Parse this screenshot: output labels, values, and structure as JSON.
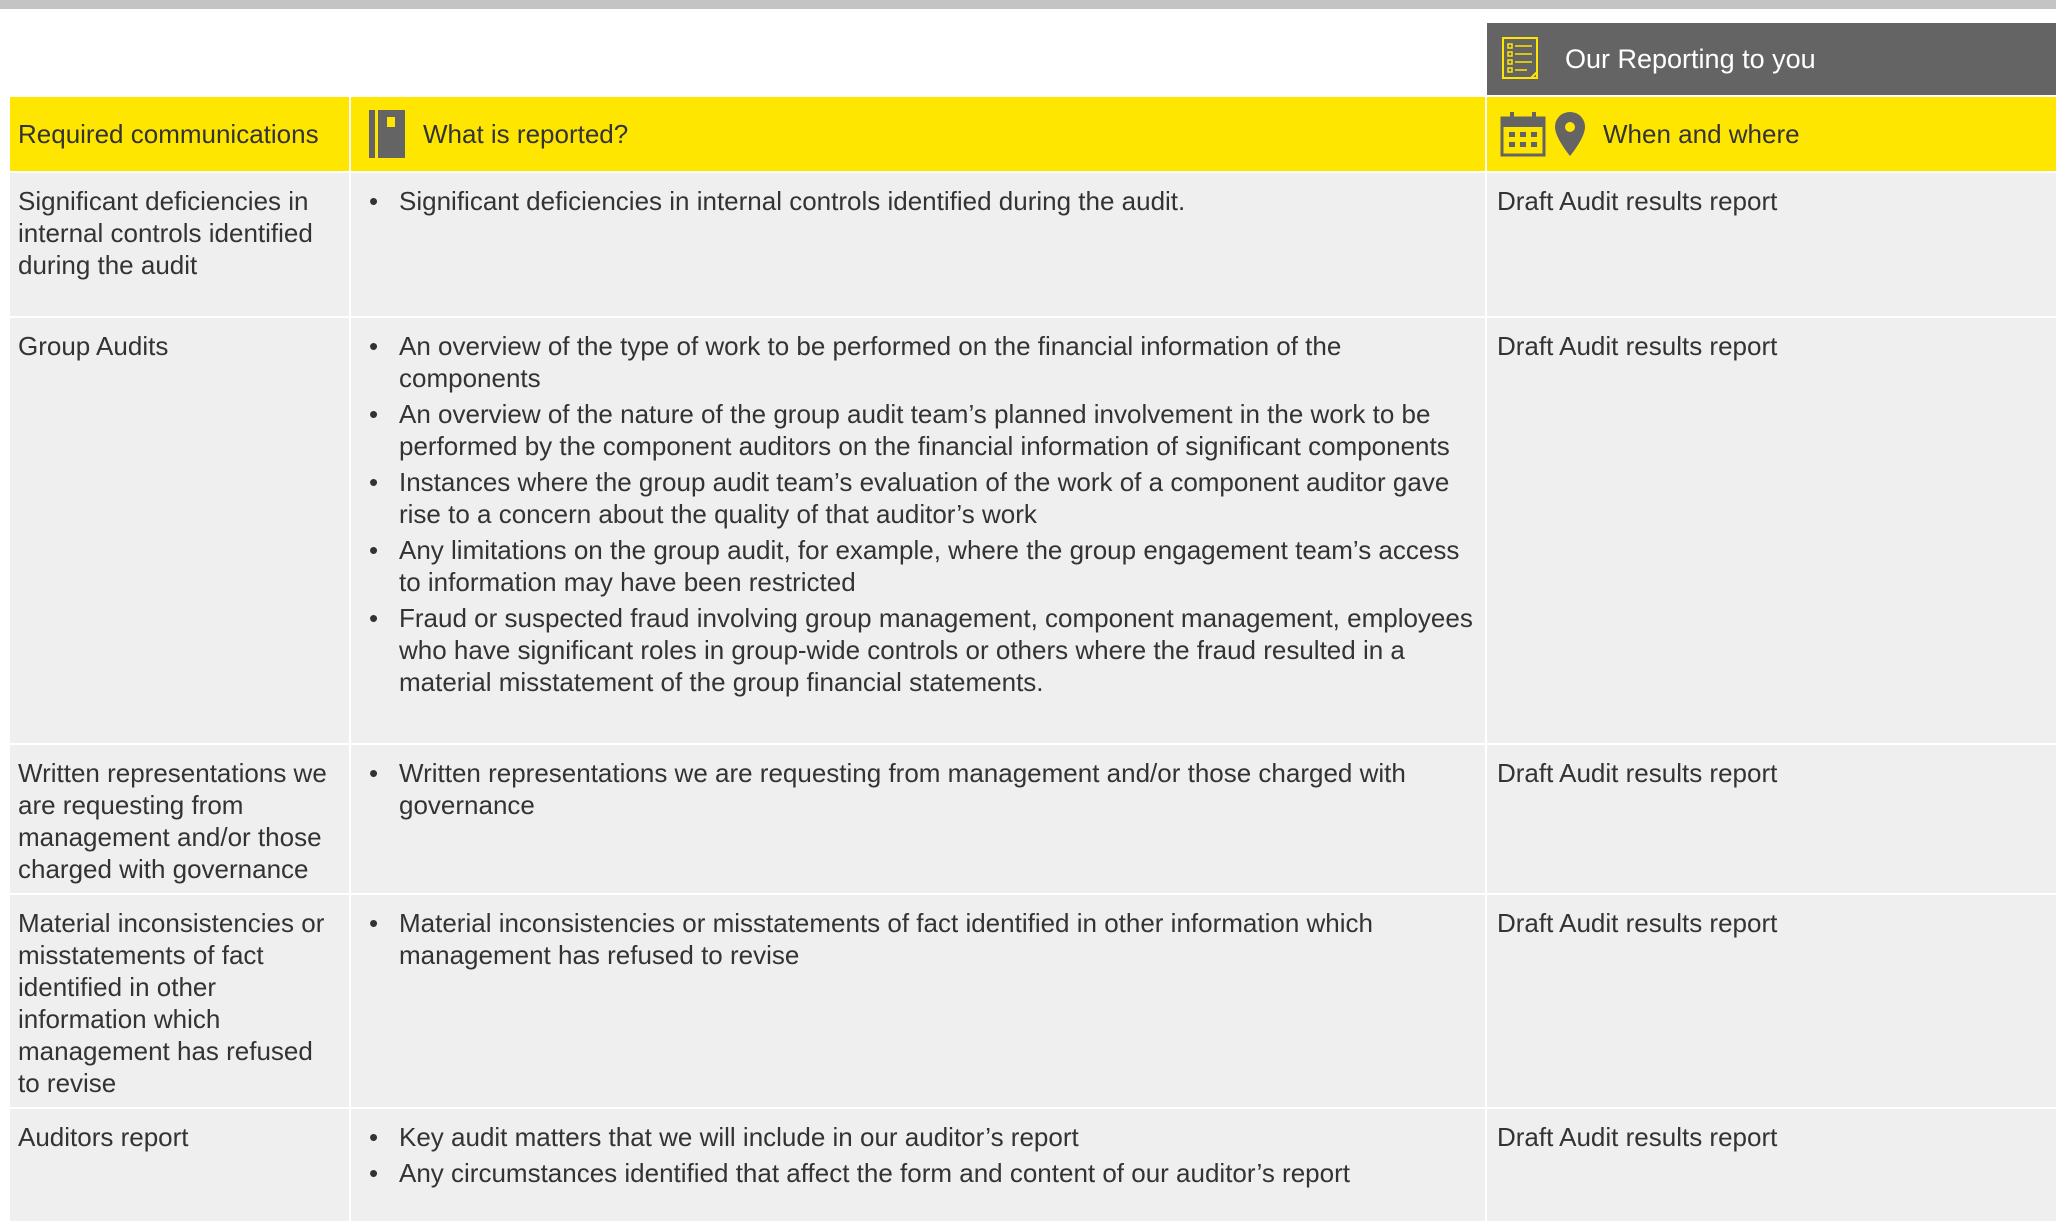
{
  "banner": {
    "title": "Our Reporting to you"
  },
  "header": {
    "col1": "Required communications",
    "col2": "What is reported?",
    "col3": "When and where"
  },
  "rows": [
    {
      "communication": "Significant deficiencies in internal controls identified during the audit",
      "items": [
        "Significant deficiencies in internal controls identified during the audit."
      ],
      "when": "Draft Audit results report"
    },
    {
      "communication": "Group Audits",
      "items": [
        "An overview of the type of work to be performed on the financial information of the components",
        "An overview of the nature of the group audit team’s planned involvement in the work to be performed by the component auditors on the financial information of significant components",
        "Instances where the group audit team’s evaluation of the work of a component auditor gave rise to a concern about the quality of that auditor’s work",
        "Any limitations on the group audit, for example, where the group engagement team’s access to information may have been restricted",
        "Fraud or suspected fraud involving group management, component management, employees who have significant roles in group-wide controls or others where the fraud resulted in a material misstatement of the group financial statements."
      ],
      "when": "Draft Audit results report"
    },
    {
      "communication": "Written representations we are requesting from management and/or those charged with governance",
      "items": [
        "Written representations we are requesting from management and/or those charged with governance"
      ],
      "when": "Draft Audit results report"
    },
    {
      "communication": "Material inconsistencies or misstatements of fact identified in other information which management has refused to revise",
      "items": [
        "Material inconsistencies or misstatements of fact identified in other information which management has refused to revise"
      ],
      "when": "Draft Audit results report"
    },
    {
      "communication": "Auditors report",
      "items": [
        "Key audit matters that we will include in our auditor’s report",
        "Any circumstances identified that affect the form and content of our auditor’s report"
      ],
      "when": "Draft Audit results report"
    }
  ],
  "colors": {
    "accent": "#ffe600",
    "banner": "#646464",
    "row_bg": "#efefef",
    "rule": "#c4c4c4"
  },
  "icons": [
    "checklist-icon",
    "notebook-icon",
    "calendar-icon",
    "map-pin-icon"
  ]
}
